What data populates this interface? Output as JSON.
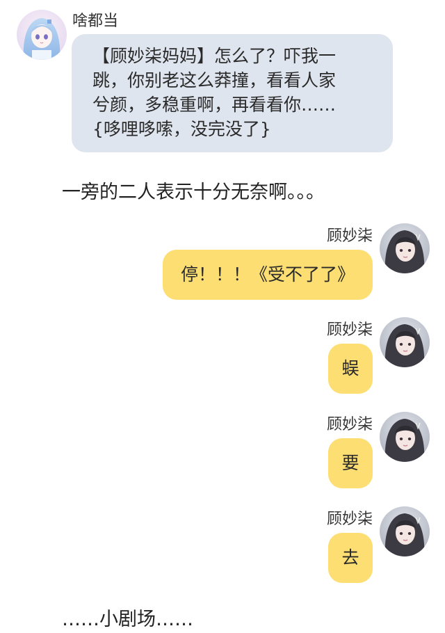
{
  "chat": {
    "messages": [
      {
        "sender": "啥都当",
        "side": "left",
        "avatar_icon": "anime-girl-blue-hair-icon",
        "lines": [
          "【顾妙柒妈妈】怎么了？吓我一",
          "跳，你别老这么莽撞，看看人家",
          "兮颜，多稳重啊，再看看你……",
          "{哆哩哆嗦，没完没了}"
        ]
      },
      {
        "sender": "顾妙柒",
        "side": "right",
        "avatar_icon": "girl-portrait-icon",
        "text": "停！！！《受不了了》"
      },
      {
        "sender": "顾妙柒",
        "side": "right",
        "avatar_icon": "girl-portrait-icon",
        "text": "蜈"
      },
      {
        "sender": "顾妙柒",
        "side": "right",
        "avatar_icon": "girl-portrait-icon",
        "text": "要"
      },
      {
        "sender": "顾妙柒",
        "side": "right",
        "avatar_icon": "girl-portrait-icon",
        "text": "去"
      }
    ],
    "narrations": [
      "一旁的二人表示十分无奈啊。。。",
      "……小剧场……"
    ]
  },
  "colors": {
    "left_bubble": "#dfe5ee",
    "right_bubble": "#fdde72",
    "background": "#ffffff"
  }
}
